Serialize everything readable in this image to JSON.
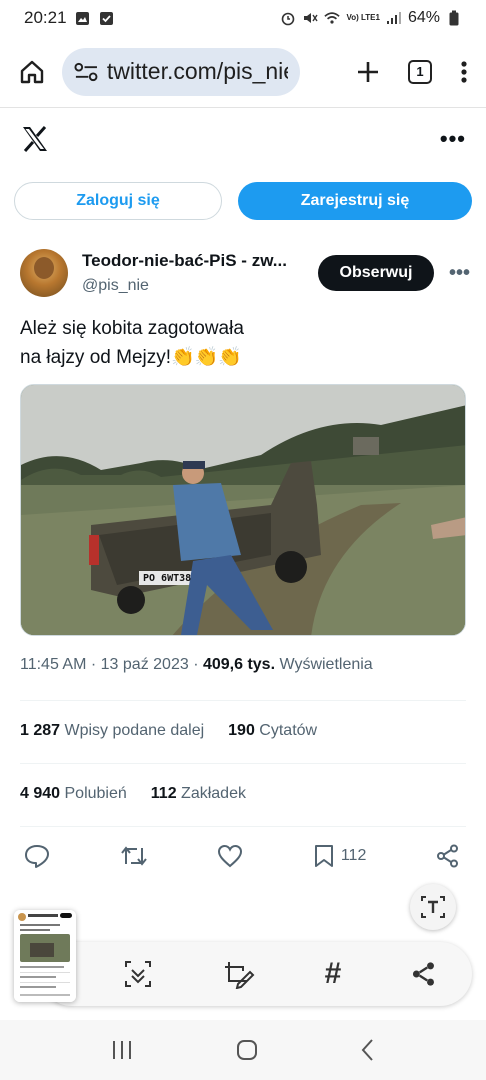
{
  "status_bar": {
    "time": "20:21",
    "battery": "64%",
    "network": "Vo) LTE1"
  },
  "browser": {
    "url": "twitter.com/pis_nie",
    "tab_count": "1"
  },
  "auth": {
    "login_label": "Zaloguj się",
    "signup_label": "Zarejestruj się"
  },
  "tweet": {
    "display_name": "Teodor-nie-bać-PiS - zw...",
    "handle": "@pis_nie",
    "follow_label": "Obserwuj",
    "text": "Ależ się kobita zagotowała\nna łajzy od Mejzy!👏👏👏",
    "time": "11:45 AM",
    "date": "13 paź 2023",
    "views_value": "409,6 tys.",
    "views_label": "Wyświetlenia",
    "media_plate": "PO 6WT38",
    "stats": {
      "retweets_value": "1 287",
      "retweets_label": "Wpisy podane dalej",
      "quotes_value": "190",
      "quotes_label": "Cytatów",
      "likes_value": "4 940",
      "likes_label": "Polubień",
      "bookmarks_value": "112",
      "bookmarks_label": "Zakładek"
    },
    "bookmark_count": "112"
  },
  "icons": {
    "status": [
      "gallery-icon",
      "check-icon",
      "alarm-icon",
      "mute-icon",
      "wifi-icon",
      "signal-icon",
      "battery-icon"
    ],
    "browser": [
      "home-icon",
      "site-settings-icon",
      "new-tab-icon",
      "tab-switcher-icon",
      "menu-dots-icon"
    ],
    "actions": [
      "reply-icon",
      "retweet-icon",
      "like-icon",
      "bookmark-icon",
      "share-icon"
    ],
    "tools": [
      "text-extract-icon",
      "scan-icon",
      "edit-icon",
      "hashtag-icon",
      "share-icon"
    ],
    "nav": [
      "recents-icon",
      "home-nav-icon",
      "back-icon"
    ]
  },
  "colors": {
    "accent": "#1d9bf0",
    "text": "#0f1419",
    "muted": "#536471",
    "url_pill": "#dfe7f2"
  }
}
